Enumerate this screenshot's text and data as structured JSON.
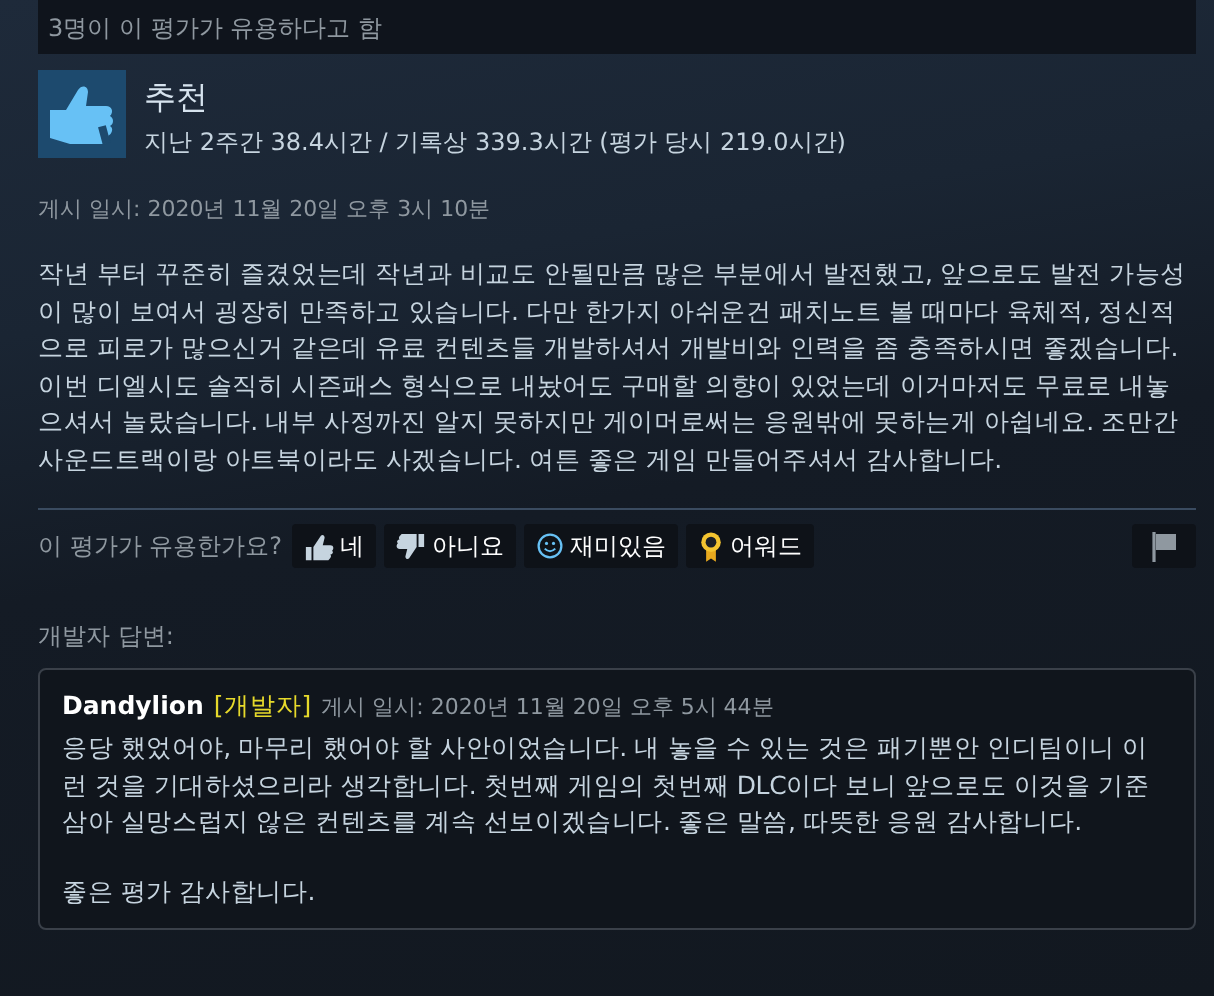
{
  "helpful_banner": "3명이 이 평가가 유용하다고 함",
  "review": {
    "verdict": "추천",
    "hours": "지난 2주간 38.4시간 / 기록상 339.3시간 (평가 당시 219.0시간)",
    "posted": "게시 일시: 2020년 11월 20일 오후 3시 10분",
    "body": "작년 부터 꾸준히 즐겼었는데 작년과 비교도 안될만큼 많은 부분에서 발전했고, 앞으로도 발전 가능성이 많이 보여서 굉장히 만족하고 있습니다. 다만 한가지 아쉬운건 패치노트 볼 때마다 육체적, 정신적으로 피로가 많으신거 같은데 유료 컨텐츠들 개발하셔서 개발비와 인력을 좀 충족하시면 좋겠습니다. 이번 디엘시도 솔직히 시즌패스 형식으로 내놨어도 구매할 의향이 있었는데 이거마저도 무료로 내놓으셔서 놀랐습니다. 내부 사정까진 알지 못하지만 게이머로써는 응원밖에 못하는게 아쉽네요. 조만간 사운드트랙이랑 아트북이라도 사겠습니다. 여튼 좋은 게임 만들어주셔서 감사합니다."
  },
  "vote": {
    "question": "이 평가가 유용한가요?",
    "buttons": [
      {
        "kind": "yes",
        "label": "네"
      },
      {
        "kind": "no",
        "label": "아니요"
      },
      {
        "kind": "funny",
        "label": "재미있음"
      },
      {
        "kind": "award",
        "label": "어워드"
      }
    ]
  },
  "developer_response": {
    "heading": "개발자 답변:",
    "author": "Dandylion",
    "badge": "[개발자]",
    "posted": "게시 일시: 2020년 11월 20일 오후 5시 44분",
    "paragraphs": [
      "응당 했었어야, 마무리 했어야 할 사안이었습니다. 내 놓을 수 있는 것은 패기뿐안 인디팀이니 이런 것을 기대하셨으리라 생각합니다. 첫번째 게임의 첫번째 DLC이다 보니 앞으로도 이것을 기준삼아 실망스럽지 않은 컨텐츠를 계속 선보이겠습니다. 좋은 말씀, 따뜻한 응원 감사합니다.",
      "좋은 평가 감사합니다."
    ]
  }
}
